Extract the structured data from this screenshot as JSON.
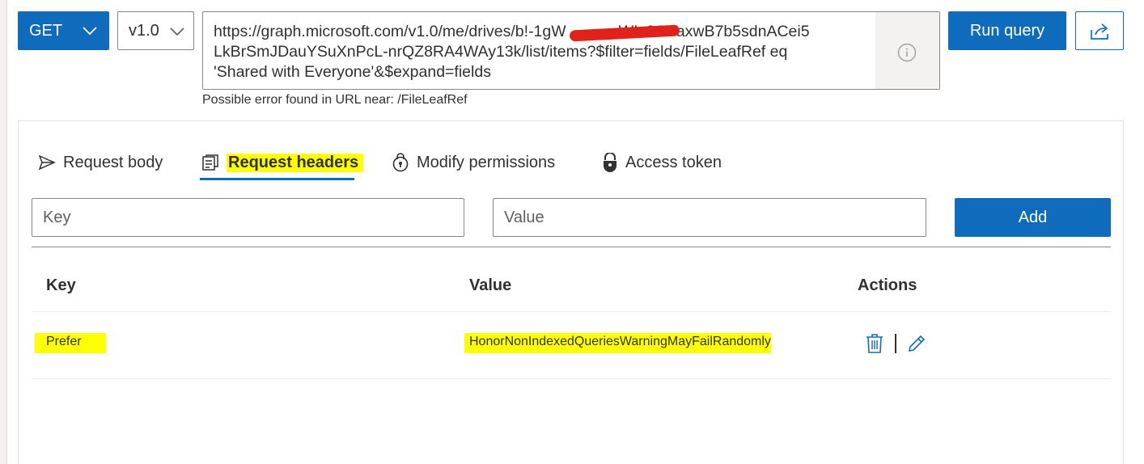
{
  "query": {
    "method": "GET",
    "version": "v1.0",
    "url": "https://graph.microsoft.com/v1.0/me/drives/b!-1gW...qwJlx6OVaxwB7b5sdnACei5LkBrSmJDauYSuXnPcL-nrQZ8RA4WAy13k/list/items?$filter=fields/FileLeafRef eq 'Shared with Everyone'&$expand=fields",
    "url_line1": "https://graph.microsoft.com/v1.0/me/drives/b!-1gW            WIx6OVaxwB7b5sdnACei5",
    "url_line2": "LkBrSmJDauYSuXnPcL-nrQZ8RA4WAy13k/list/items?$filter=fields/FileLeafRef eq",
    "url_line3": "'Shared with Everyone'&$expand=fields",
    "error": "Possible error found in URL near: /FileLeafRef",
    "run_label": "Run query"
  },
  "tabs": [
    {
      "label": "Request body",
      "icon": "send-icon"
    },
    {
      "label": "Request headers",
      "icon": "document-icon"
    },
    {
      "label": "Modify permissions",
      "icon": "lock-icon"
    },
    {
      "label": "Access token",
      "icon": "shield-lock-icon"
    }
  ],
  "header_form": {
    "key_placeholder": "Key",
    "value_placeholder": "Value",
    "add_label": "Add"
  },
  "table": {
    "columns": [
      "Key",
      "Value",
      "Actions"
    ],
    "rows": [
      {
        "key": "Prefer",
        "value": "HonorNonIndexedQueriesWarningMayFailRandomly"
      }
    ]
  },
  "colors": {
    "accent": "#0f6cbd",
    "highlight": "#ffff00",
    "redaction": "#e0221b"
  }
}
